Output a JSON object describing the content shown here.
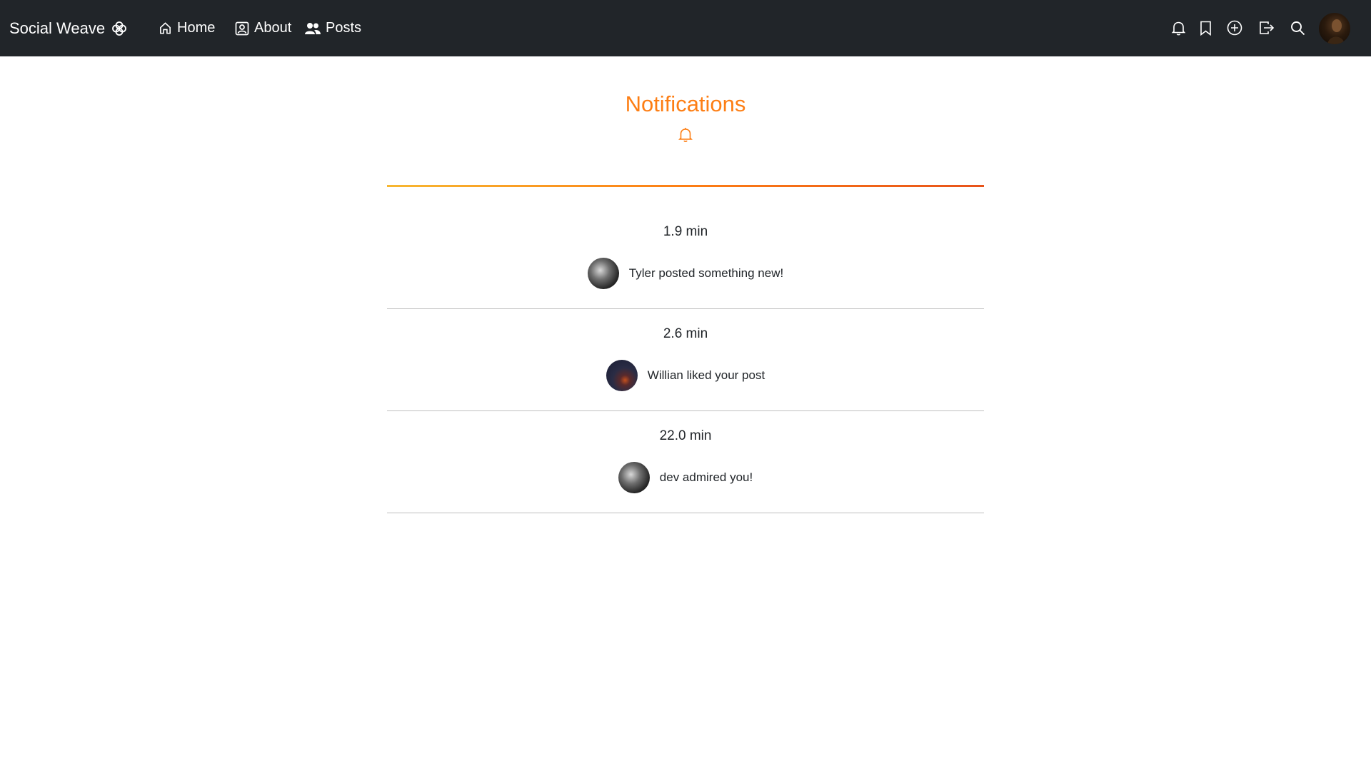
{
  "nav": {
    "brand": "Social Weave",
    "links": [
      {
        "label": "Home",
        "icon": "house-icon"
      },
      {
        "label": "About",
        "icon": "person-badge-icon"
      },
      {
        "label": "Posts",
        "icon": "people-icon"
      }
    ],
    "right_icons": [
      "bell-icon",
      "bookmark-icon",
      "plus-circle-icon",
      "logout-icon",
      "search-icon"
    ]
  },
  "page": {
    "title": "Notifications",
    "title_icon": "bell-icon"
  },
  "notifications": [
    {
      "time": "1.9 min",
      "message": "Tyler posted something new!",
      "avatar": "bw-portrait"
    },
    {
      "time": "2.6 min",
      "message": "Willian liked your post",
      "avatar": "night-scene"
    },
    {
      "time": "22.0 min",
      "message": "dev admired you!",
      "avatar": "bw-portrait"
    }
  ],
  "colors": {
    "navbar_bg": "#212529",
    "accent": "#fd7e14"
  }
}
